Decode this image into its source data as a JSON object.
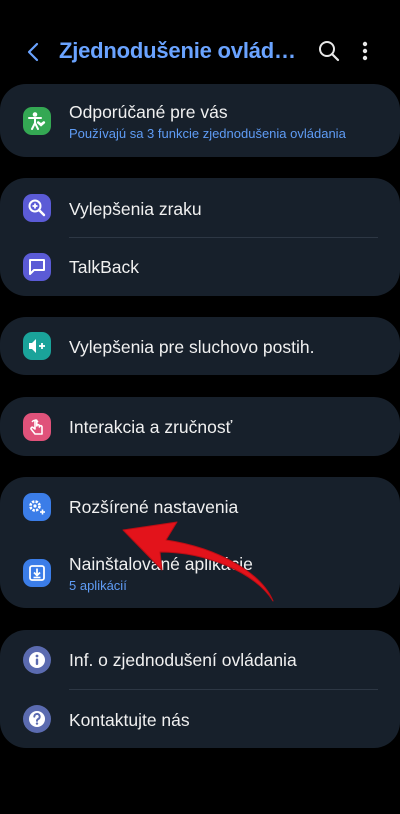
{
  "header": {
    "title": "Zjednodušenie ovládania",
    "back_icon": "back-arrow-icon",
    "search_icon": "search-icon",
    "more_icon": "more-vertical-icon"
  },
  "cards": {
    "recommended": {
      "label": "Odporúčané pre vás",
      "sublabel": "Používajú sa 3 funkcie zjednodušenia ovládania",
      "icon": "accessibility-person-icon",
      "icon_color": "#34a853"
    },
    "vision": {
      "label": "Vylepšenia zraku",
      "icon": "magnifier-plus-icon",
      "icon_color": "#5b5bd6"
    },
    "talkback": {
      "label": "TalkBack",
      "icon": "speech-bubble-icon",
      "icon_color": "#5b5bd6"
    },
    "hearing": {
      "label": "Vylepšenia pre sluchovo postih.",
      "icon": "volume-plus-icon",
      "icon_color": "#1aa39a"
    },
    "interaction": {
      "label": "Interakcia a zručnosť",
      "icon": "touch-hand-icon",
      "icon_color": "#e0527a"
    },
    "advanced": {
      "label": "Rozšírené nastavenia",
      "icon": "gear-plus-icon",
      "icon_color": "#3b7de8"
    },
    "installed": {
      "label": "Nainštalované aplikácie",
      "sublabel": "5 aplikácií",
      "icon": "download-box-icon",
      "icon_color": "#3b7de8"
    },
    "info": {
      "label": "Inf. o zjednodušení ovládania",
      "icon": "info-icon",
      "icon_color": "#5b6bb0"
    },
    "contact": {
      "label": "Kontaktujte nás",
      "icon": "question-icon",
      "icon_color": "#5b6bb0"
    }
  },
  "annotation": {
    "arrow_color": "#e3131b",
    "arrow_icon": "red-annotation-arrow"
  }
}
